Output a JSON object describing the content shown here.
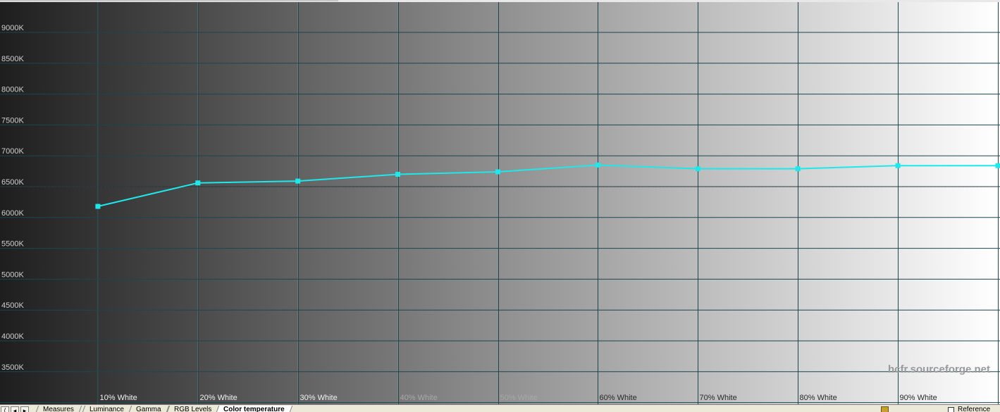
{
  "chart_data": {
    "type": "line",
    "title": "",
    "xlabel": "",
    "ylabel": "",
    "y_tick_labels": [
      "3500K",
      "4000K",
      "4500K",
      "5000K",
      "5500K",
      "6000K",
      "6500K",
      "7000K",
      "7500K",
      "8000K",
      "8500K",
      "9000K"
    ],
    "y_ticks": [
      3500,
      4000,
      4500,
      5000,
      5500,
      6000,
      6500,
      7000,
      7500,
      8000,
      8500,
      9000
    ],
    "ylim": [
      3000,
      9300
    ],
    "x_tick_labels": [
      "10% White",
      "20% White",
      "30% White",
      "40% White",
      "50% White",
      "60% White",
      "70% White",
      "80% White",
      "90% White"
    ],
    "x": [
      10,
      20,
      30,
      40,
      50,
      60,
      70,
      80,
      90,
      100
    ],
    "xlim": [
      0,
      100
    ],
    "series": [
      {
        "values": [
          6180,
          6560,
          6590,
          6700,
          6740,
          6850,
          6790,
          6790,
          6840,
          6840
        ]
      }
    ],
    "reference_line": 6500,
    "grid": true,
    "background": "grayscale gradient from 0% to 100% white",
    "series_color": "#1ee8ea",
    "reference_line_color": "#333333",
    "grid_color": "#1c4650",
    "watermark": "hcfr.sourceforge.net"
  },
  "tabs": {
    "nav_buttons": [
      "⟨",
      "◂",
      "▸"
    ],
    "items": [
      "Measures",
      "Luminance",
      "Gamma",
      "RGB Levels",
      "Color temperature"
    ],
    "active_index": 4
  },
  "reference_checkbox": {
    "label": "Reference",
    "checked": false
  }
}
